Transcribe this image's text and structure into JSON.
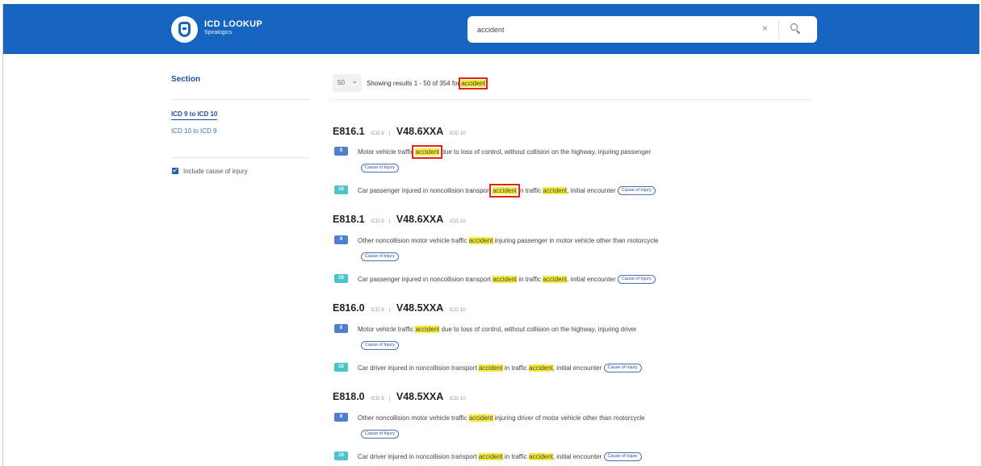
{
  "header": {
    "app_title": "ICD LOOKUP",
    "app_subtitle": "Spiralogics",
    "search_value": "accident",
    "clear_glyph": "×",
    "icons": {
      "logo": "shield-logo-icon",
      "clear": "close-icon",
      "search": "search-icon"
    },
    "colors": {
      "bar": "#1565c0"
    }
  },
  "sidebar": {
    "title": "Section",
    "links": [
      "ICD 9 to ICD 10",
      "ICD 10 to ICD 9"
    ],
    "checkbox_label": "Include cause of injury",
    "checkbox_checked": true
  },
  "results_header": {
    "per_page": "50",
    "showing_text": "Showing results 1 - 50 of 354 for",
    "query": "accident"
  },
  "results": [
    {
      "icd9": "E816.1",
      "icd9_tag": "ICD 9",
      "sep": "|",
      "icd10": "V48.6XXA",
      "icd10_tag": "ICD 10",
      "icd9_badge": "9",
      "icd10_badge": "10",
      "icd9_desc": [
        "Motor vehicle traffic",
        "accident",
        "due to loss of control, without collision on the highway, injuring passenger"
      ],
      "icd10_desc": [
        "Car passenger injured in noncollision transport",
        "accident",
        "in traffic",
        "accident",
        ", initial encounter"
      ],
      "pill": "Cause of Injury"
    },
    {
      "icd9": "E818.1",
      "icd9_tag": "ICD 9",
      "sep": "|",
      "icd10": "V48.6XXA",
      "icd10_tag": "ICD 10",
      "icd9_badge": "9",
      "icd10_badge": "10",
      "icd9_desc": [
        "Other noncollision motor vehicle traffic",
        "accident",
        "injuring passenger in motor vehicle other than motorcycle"
      ],
      "icd10_desc": [
        "Car passenger injured in noncollision transport",
        "accident",
        "in traffic",
        "accident",
        ", initial encounter"
      ],
      "pill": "Cause of Injury"
    },
    {
      "icd9": "E816.0",
      "icd9_tag": "ICD 9",
      "sep": "|",
      "icd10": "V48.5XXA",
      "icd10_tag": "ICD 10",
      "icd9_badge": "9",
      "icd10_badge": "10",
      "icd9_desc": [
        "Motor vehicle traffic",
        "accident",
        "due to loss of control, without collision on the highway, injuring driver"
      ],
      "icd10_desc": [
        "Car driver injured in noncollision transport",
        "accident",
        "in traffic",
        "accident",
        ", initial encounter"
      ],
      "pill": "Cause of Injury"
    },
    {
      "icd9": "E818.0",
      "icd9_tag": "ICD 9",
      "sep": "|",
      "icd10": "V48.5XXA",
      "icd10_tag": "ICD 10",
      "icd9_badge": "9",
      "icd10_badge": "10",
      "icd9_desc": [
        "Other noncollision motor vehicle traffic",
        "accident",
        "injuring driver of motor vehicle other than motorcycle"
      ],
      "icd10_desc": [
        "Car driver injured in noncollision transport",
        "accident",
        "in traffic",
        "accident",
        ", initial encounter"
      ],
      "pill": "Cause of Injury"
    }
  ],
  "colors": {
    "highlight": "#f7ee3c",
    "annotation_box": "#e0261b"
  }
}
